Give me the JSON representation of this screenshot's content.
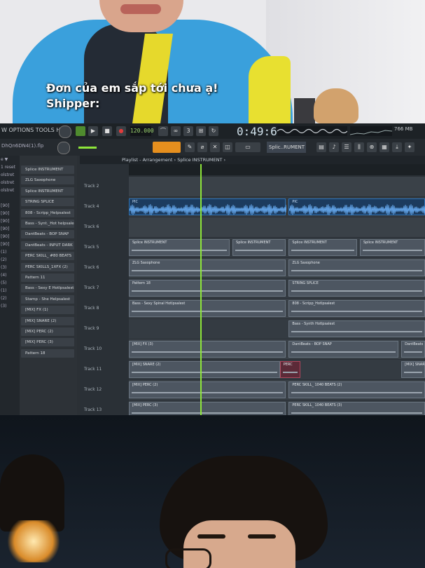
{
  "overlay_text": {
    "line1": "Đơn của em sắp tới chưa ạ!",
    "line2": "Shipper:"
  },
  "fl": {
    "menu": "W  OPTIONS  TOOLS  HELP",
    "tempo": "120.000",
    "time": "0:49:67",
    "cpu": "766 MB",
    "file": "DhQn6DN4(1).flp",
    "pattern": "Splic..RUMENT",
    "playlist_title": "Playlist - Arrangement › Splice INSTRUMENT ›",
    "browser": [
      "e ▼",
      "1 reset",
      "olstret",
      "olstret",
      "olstret",
      "",
      "[90]",
      "[90]",
      "[90]",
      "[90]",
      "[90]",
      "[90]",
      "(1)",
      "(2)",
      "(3)",
      "(4)",
      "(5)",
      "(1)",
      "(2)",
      "(3)"
    ],
    "channels": [
      "Splice INSTRUMENT",
      "ZLG Saxophone",
      "Splice INSTRUMENT",
      "STRING SPLICE",
      "808 - Scripp_Helpsalest",
      "Bass - Synt._Hot helpsalest",
      "DantBeats - BOP SNAP",
      "DantBeats - INPUT DARK",
      "PERC SKILL_ #80 BEATS",
      "PERC SKILLS_1XFX (2)",
      "Pattern 11",
      "Bass - Sexy E Hotlpsalest",
      "Stamp - She Helpsalest",
      "[MIX] FX (1)",
      "[MIX] SNARE (2)",
      "[MIX] PERC (2)",
      "[MIX] PERC (3)",
      "Pattern 18"
    ],
    "tracks": [
      {
        "label": "Track 2",
        "clips": []
      },
      {
        "label": "Track 4",
        "clips": [
          {
            "name": "PIC",
            "type": "audio",
            "start": 0.0,
            "end": 0.53
          },
          {
            "name": "PIC",
            "type": "audio",
            "start": 0.54,
            "end": 1.0
          }
        ]
      },
      {
        "label": "Track 6",
        "clips": []
      },
      {
        "label": "Track 5",
        "clips": [
          {
            "name": "Splice INSTRUMENT",
            "type": "pattern",
            "start": 0.0,
            "end": 0.34
          },
          {
            "name": "Splice INSTRUMENT",
            "type": "pattern",
            "start": 0.35,
            "end": 0.53
          },
          {
            "name": "Splice INSTRUMENT",
            "type": "pattern",
            "start": 0.54,
            "end": 0.77
          },
          {
            "name": "Splice INSTRUMENT",
            "type": "pattern",
            "start": 0.78,
            "end": 1.0
          }
        ]
      },
      {
        "label": "Track 6",
        "clips": [
          {
            "name": "ZLG Saxophone",
            "type": "pattern",
            "start": 0.0,
            "end": 0.53
          },
          {
            "name": "ZLG Saxophone",
            "type": "pattern",
            "start": 0.54,
            "end": 1.0
          }
        ]
      },
      {
        "label": "Track 7",
        "clips": [
          {
            "name": "Pattern 18",
            "type": "pattern",
            "start": 0.0,
            "end": 0.53
          },
          {
            "name": "STRING SPLICE",
            "type": "pattern",
            "start": 0.54,
            "end": 1.0
          }
        ]
      },
      {
        "label": "Track 8",
        "clips": [
          {
            "name": "Bass - Sexy Spinal Hotlpsalest",
            "type": "pattern",
            "start": 0.0,
            "end": 0.53
          },
          {
            "name": "808 - Scripp_Hotlpsalest",
            "type": "pattern",
            "start": 0.54,
            "end": 1.0
          }
        ]
      },
      {
        "label": "Track 9",
        "clips": [
          {
            "name": "Bass - Synth Hotlpsalest",
            "type": "pattern",
            "start": 0.54,
            "end": 1.0
          }
        ]
      },
      {
        "label": "Track 10",
        "clips": [
          {
            "name": "[MIX] FX (3)",
            "type": "pattern",
            "start": 0.0,
            "end": 0.53
          },
          {
            "name": "DantBeats - BOP SNAP",
            "type": "pattern",
            "start": 0.54,
            "end": 0.91
          },
          {
            "name": "DantBeats",
            "type": "pattern",
            "start": 0.92,
            "end": 1.0
          }
        ]
      },
      {
        "label": "Track 11",
        "clips": [
          {
            "name": "[MIX] SNARE (2)",
            "type": "pattern",
            "start": 0.0,
            "end": 0.51
          },
          {
            "name": "PERC",
            "type": "red",
            "start": 0.51,
            "end": 0.58
          },
          {
            "name": "[MIX] SNARE",
            "type": "pattern",
            "start": 0.92,
            "end": 1.0
          }
        ]
      },
      {
        "label": "Track 12",
        "clips": [
          {
            "name": "[MIX] PERC (2)",
            "type": "pattern",
            "start": 0.0,
            "end": 0.53
          },
          {
            "name": "PERC SKILL_ 1040 BEATS (2)",
            "type": "pattern",
            "start": 0.54,
            "end": 1.0
          }
        ]
      },
      {
        "label": "Track 13",
        "clips": [
          {
            "name": "[MIX] PERC (3)",
            "type": "pattern",
            "start": 0.0,
            "end": 0.53
          },
          {
            "name": "PERC SKILL_ 1040 BEATS (3)",
            "type": "pattern",
            "start": 0.54,
            "end": 1.0
          }
        ]
      }
    ],
    "playhead_position": 0.24
  },
  "colors": {
    "accent": "#e68f1e",
    "playhead": "#8ee63a",
    "audio_clip": "#2e73b6"
  }
}
